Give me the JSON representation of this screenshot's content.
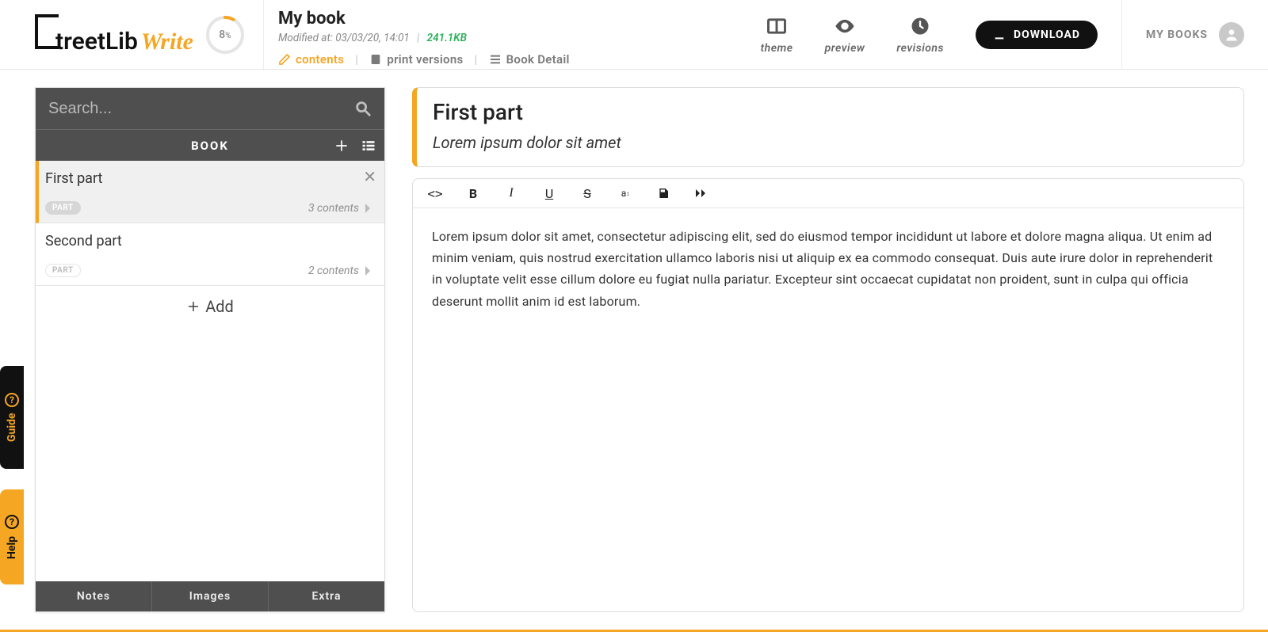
{
  "logo": {
    "streetlib": "treetLib",
    "write": "Write"
  },
  "progress": {
    "percent": "8",
    "suffix": "%"
  },
  "book": {
    "title": "My book",
    "modified_label": "Modified at: 03/03/20, 14:01",
    "size": "241.1KB",
    "tabs": {
      "contents": "contents",
      "print": "print versions",
      "detail": "Book Detail"
    }
  },
  "headerActions": {
    "theme": "theme",
    "preview": "preview",
    "revisions": "revisions",
    "download": "DOWNLOAD",
    "mybooks": "MY BOOKS"
  },
  "sidebar": {
    "search_placeholder": "Search...",
    "book_label": "BOOK",
    "add_label": "Add",
    "part_badge": "PART",
    "parts": [
      {
        "title": "First part",
        "count": "3 contents"
      },
      {
        "title": "Second part",
        "count": "2 contents"
      }
    ],
    "bottom": {
      "notes": "Notes",
      "images": "Images",
      "extra": "Extra"
    }
  },
  "editor": {
    "title": "First part",
    "subtitle": "Lorem ipsum dolor sit amet",
    "body": "Lorem ipsum dolor sit amet, consectetur adipiscing elit, sed do eiusmod tempor incididunt ut labore et dolore magna aliqua. Ut enim ad minim veniam, quis nostrud exercitation ullamco laboris nisi ut aliquip ex ea commodo consequat. Duis aute irure dolor in reprehenderit in voluptate velit esse cillum dolore eu fugiat nulla pariatur. Excepteur sint occaecat cupidatat non proident, sunt in culpa qui officia deserunt mollit anim  id est laborum."
  },
  "sideTabs": {
    "guide": "Guide",
    "help": "Help"
  }
}
